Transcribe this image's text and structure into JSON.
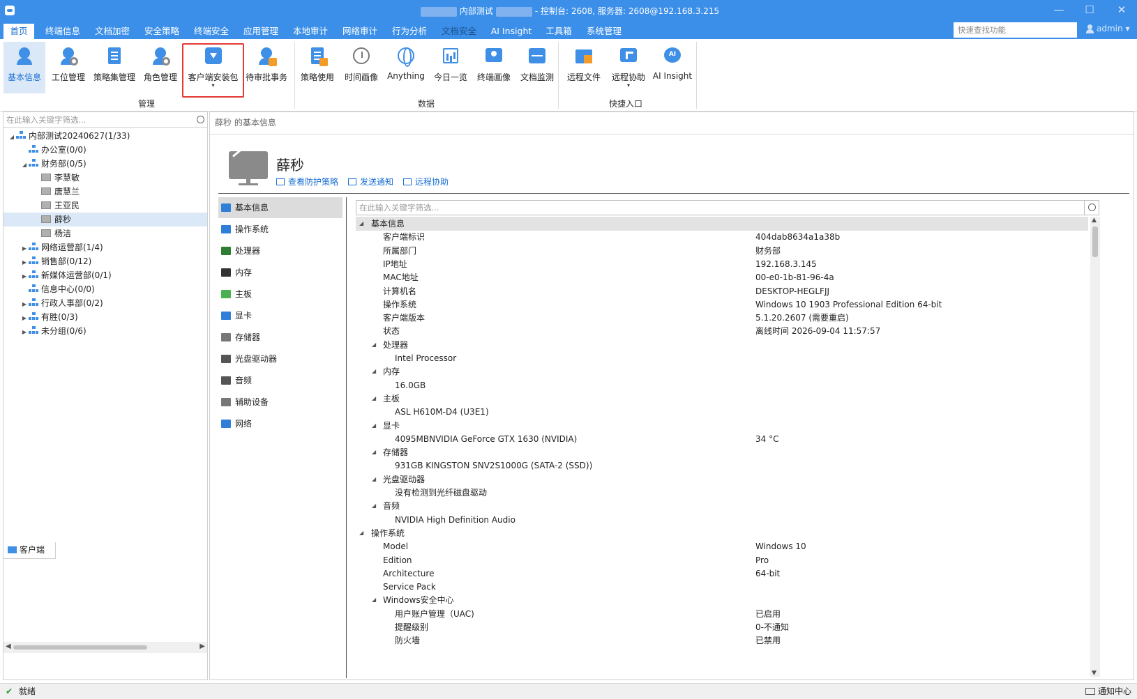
{
  "title_bar": {
    "title_prefix": "内部测试",
    "title_suffix": "- 控制台: 2608, 服务器: 2608@192.168.3.215",
    "minimize": "—",
    "maximize": "☐",
    "close": "✕"
  },
  "tabs": [
    {
      "label": "首页",
      "state": "active"
    },
    {
      "label": "终端信息"
    },
    {
      "label": "文档加密"
    },
    {
      "label": "安全策略"
    },
    {
      "label": "终端安全"
    },
    {
      "label": "应用管理"
    },
    {
      "label": "本地审计"
    },
    {
      "label": "网络审计"
    },
    {
      "label": "行为分析"
    },
    {
      "label": "文档安全",
      "state": "dim"
    },
    {
      "label": "AI Insight"
    },
    {
      "label": "工具箱"
    },
    {
      "label": "系统管理"
    }
  ],
  "quick_search": {
    "placeholder": "快速查找功能"
  },
  "user": {
    "name": "admin",
    "caret": "▾"
  },
  "ribbon": {
    "groups": {
      "manage": "管理",
      "data": "数据",
      "shortcut": "快捷入口"
    },
    "buttons": [
      {
        "label": "基本信息",
        "icon": "user-info-icon",
        "selected": true
      },
      {
        "label": "工位管理",
        "icon": "workstation-icon"
      },
      {
        "label": "策略集管理",
        "icon": "policy-set-icon"
      },
      {
        "label": "角色管理",
        "icon": "role-icon"
      },
      {
        "label": "客户端安装包",
        "icon": "install-package-icon",
        "caret": "▾"
      },
      {
        "label": "待审批事务",
        "icon": "approval-icon"
      },
      {
        "label": "策略使用",
        "icon": "policy-usage-icon"
      },
      {
        "label": "时间画像",
        "icon": "clock-icon"
      },
      {
        "label": "Anything",
        "icon": "globe-icon"
      },
      {
        "label": "今日一览",
        "icon": "calendar-chart-icon"
      },
      {
        "label": "终端画像",
        "icon": "terminal-profile-icon"
      },
      {
        "label": "文档监测",
        "icon": "document-monitor-icon"
      },
      {
        "label": "远程文件",
        "icon": "remote-file-icon"
      },
      {
        "label": "远程协助",
        "icon": "remote-assist-icon",
        "caret": "▾"
      },
      {
        "label": "AI Insight",
        "icon": "ai-chat-icon"
      }
    ]
  },
  "left_panel": {
    "search_placeholder": "在此输入关键字筛选...",
    "tree": [
      {
        "label": "内部测试20240627(1/33)",
        "level": 0,
        "type": "org",
        "expanded": true
      },
      {
        "label": "办公室(0/0)",
        "level": 1,
        "type": "org"
      },
      {
        "label": "财务部(0/5)",
        "level": 1,
        "type": "org",
        "expanded": true
      },
      {
        "label": "李慧敏",
        "level": 2,
        "type": "pc"
      },
      {
        "label": "唐慧兰",
        "level": 2,
        "type": "pc"
      },
      {
        "label": "王亚民",
        "level": 2,
        "type": "pc"
      },
      {
        "label": "薛秒",
        "level": 2,
        "type": "pc",
        "selected": true
      },
      {
        "label": "杨洁",
        "level": 2,
        "type": "pc"
      },
      {
        "label": "网络运营部(1/4)",
        "level": 1,
        "type": "org",
        "collapsed": true
      },
      {
        "label": "销售部(0/12)",
        "level": 1,
        "type": "org",
        "collapsed": true
      },
      {
        "label": "新媒体运营部(0/1)",
        "level": 1,
        "type": "org",
        "collapsed": true
      },
      {
        "label": "信息中心(0/0)",
        "level": 1,
        "type": "org"
      },
      {
        "label": "行政人事部(0/2)",
        "level": 1,
        "type": "org",
        "collapsed": true
      },
      {
        "label": "有胜(0/3)",
        "level": 1,
        "type": "org",
        "collapsed": true
      },
      {
        "label": "未分组(0/6)",
        "level": 1,
        "type": "org",
        "collapsed": true
      }
    ],
    "bottom_tab": "客户端"
  },
  "main": {
    "breadcrumb": "薛秒 的基本信息",
    "user_name": "薛秒",
    "actions": [
      {
        "label": "查看防护策略",
        "icon": "policy-view-icon"
      },
      {
        "label": "发送通知",
        "icon": "send-notice-icon"
      },
      {
        "label": "远程协助",
        "icon": "remote-assist-icon"
      }
    ],
    "categories": [
      {
        "label": "基本信息",
        "icon": "monitor-icon",
        "color": "#2f7fd8",
        "selected": true
      },
      {
        "label": "操作系统",
        "icon": "windows-icon",
        "color": "#2f7fd8"
      },
      {
        "label": "处理器",
        "icon": "cpu-icon",
        "color": "#2e7d32"
      },
      {
        "label": "内存",
        "icon": "memory-icon",
        "color": "#333333"
      },
      {
        "label": "主板",
        "icon": "motherboard-icon",
        "color": "#4caf50"
      },
      {
        "label": "显卡",
        "icon": "gpu-icon",
        "color": "#2f7fd8"
      },
      {
        "label": "存储器",
        "icon": "disk-icon",
        "color": "#777777"
      },
      {
        "label": "光盘驱动器",
        "icon": "optical-drive-icon",
        "color": "#555555"
      },
      {
        "label": "音频",
        "icon": "speaker-icon",
        "color": "#555555"
      },
      {
        "label": "辅助设备",
        "icon": "keyboard-icon",
        "color": "#777777"
      },
      {
        "label": "网络",
        "icon": "network-icon",
        "color": "#2f7fd8"
      }
    ],
    "detail_search_placeholder": "在此输入关键字筛选...",
    "rows": [
      {
        "key": "基本信息",
        "level": 0,
        "group": true,
        "expander": "◢",
        "highlight": true
      },
      {
        "key": "客户端标识",
        "value": "404dab8634a1a38b",
        "level": 1
      },
      {
        "key": "所属部门",
        "value": "财务部",
        "level": 1
      },
      {
        "key": "IP地址",
        "value": "192.168.3.145",
        "level": 1
      },
      {
        "key": "MAC地址",
        "value": "00-e0-1b-81-96-4a",
        "level": 1
      },
      {
        "key": "计算机名",
        "value": "DESKTOP-HEGLFJJ",
        "level": 1
      },
      {
        "key": "操作系统",
        "value": "Windows 10 1903 Professional Edition 64-bit",
        "level": 1
      },
      {
        "key": "客户端版本",
        "value": "5.1.20.2607 (需要重启)",
        "level": 1
      },
      {
        "key": "状态",
        "value": "离线时间 2026-09-04 11:57:57",
        "level": 1
      },
      {
        "key": "处理器",
        "level": 1,
        "group": true,
        "expander": "◢"
      },
      {
        "key": "Intel Processor",
        "level": 2
      },
      {
        "key": "内存",
        "level": 1,
        "group": true,
        "expander": "◢"
      },
      {
        "key": "16.0GB",
        "level": 2
      },
      {
        "key": "主板",
        "level": 1,
        "group": true,
        "expander": "◢"
      },
      {
        "key": "ASL H610M-D4 (U3E1)",
        "level": 2
      },
      {
        "key": "显卡",
        "level": 1,
        "group": true,
        "expander": "◢"
      },
      {
        "key": "4095MBNVIDIA GeForce GTX 1630 (NVIDIA)",
        "value": "34 °C",
        "level": 2
      },
      {
        "key": "存储器",
        "level": 1,
        "group": true,
        "expander": "◢"
      },
      {
        "key": "931GB KINGSTON SNV2S1000G (SATA-2 (SSD))",
        "level": 2
      },
      {
        "key": "光盘驱动器",
        "level": 1,
        "group": true,
        "expander": "◢"
      },
      {
        "key": "没有检测到光纤磁盘驱动",
        "level": 2
      },
      {
        "key": "音频",
        "level": 1,
        "group": true,
        "expander": "◢"
      },
      {
        "key": "NVIDIA High Definition Audio",
        "level": 2
      },
      {
        "key": "操作系统",
        "level": 0,
        "group": true,
        "expander": "◢"
      },
      {
        "key": "Model",
        "value": "Windows 10",
        "level": 1
      },
      {
        "key": "Edition",
        "value": "Pro",
        "level": 1
      },
      {
        "key": "Architecture",
        "value": "64-bit",
        "level": 1
      },
      {
        "key": "Service Pack",
        "level": 1
      },
      {
        "key": "Windows安全中心",
        "level": 1,
        "group": true,
        "expander": "◢"
      },
      {
        "key": "用户账户管理（UAC)",
        "value": "已启用",
        "level": 2
      },
      {
        "key": "提醒级别",
        "value": "0-不通知",
        "level": 2
      },
      {
        "key": "防火墙",
        "value": "已禁用",
        "level": 2
      }
    ]
  },
  "status_bar": {
    "check": "✔",
    "status": "就绪",
    "notification_center": "通知中心"
  },
  "colors": {
    "accent": "#3b8fe9",
    "highlight_border": "#e53935",
    "link": "#1a6fd4"
  }
}
